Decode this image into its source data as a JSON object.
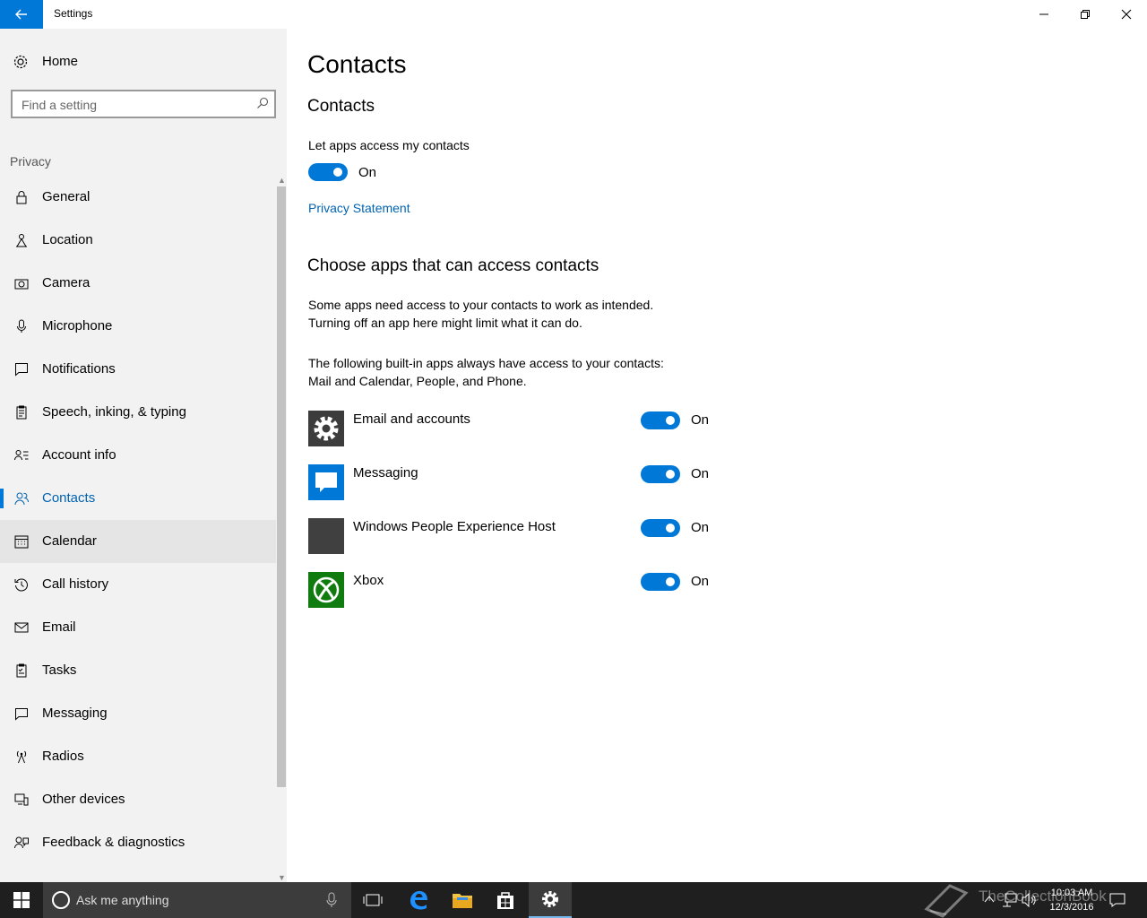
{
  "window": {
    "title": "Settings"
  },
  "sidebar": {
    "home_label": "Home",
    "search_placeholder": "Find a setting",
    "section_label": "Privacy",
    "items": [
      {
        "label": "General",
        "icon": "lock-icon"
      },
      {
        "label": "Location",
        "icon": "location-icon"
      },
      {
        "label": "Camera",
        "icon": "camera-icon"
      },
      {
        "label": "Microphone",
        "icon": "microphone-icon"
      },
      {
        "label": "Notifications",
        "icon": "notifications-icon"
      },
      {
        "label": "Speech, inking, & typing",
        "icon": "speech-icon"
      },
      {
        "label": "Account info",
        "icon": "account-info-icon"
      },
      {
        "label": "Contacts",
        "icon": "contacts-icon",
        "active": true
      },
      {
        "label": "Calendar",
        "icon": "calendar-icon",
        "hover": true
      },
      {
        "label": "Call history",
        "icon": "history-icon"
      },
      {
        "label": "Email",
        "icon": "email-icon"
      },
      {
        "label": "Tasks",
        "icon": "tasks-icon"
      },
      {
        "label": "Messaging",
        "icon": "messaging-icon"
      },
      {
        "label": "Radios",
        "icon": "radios-icon"
      },
      {
        "label": "Other devices",
        "icon": "other-devices-icon"
      },
      {
        "label": "Feedback & diagnostics",
        "icon": "feedback-icon"
      }
    ]
  },
  "main": {
    "page_title": "Contacts",
    "section1_title": "Contacts",
    "toggle_caption": "Let apps access my contacts",
    "main_toggle_state": "On",
    "privacy_link": "Privacy Statement",
    "section2_title": "Choose apps that can access contacts",
    "para1_line1": "Some apps need access to your contacts to work as intended.",
    "para1_line2": "Turning off an app here might limit what it can do.",
    "para2_line1": "The following built-in apps always have access to your contacts:",
    "para2_line2": "Mail and Calendar, People, and Phone.",
    "apps": [
      {
        "name": "Email and accounts",
        "state": "On",
        "icon": "gear-icon",
        "color": "#3c3c3c"
      },
      {
        "name": "Messaging",
        "state": "On",
        "icon": "speech-bubble-icon",
        "color": "#0078d7"
      },
      {
        "name": "Windows People Experience Host",
        "state": "On",
        "icon": "blank-app-icon",
        "color": "#404040"
      },
      {
        "name": "Xbox",
        "state": "On",
        "icon": "xbox-icon",
        "color": "#107c10"
      }
    ]
  },
  "taskbar": {
    "search_placeholder": "Ask me anything",
    "time": "10:03 AM",
    "date": "12/3/2016"
  },
  "watermark": "TheCollectionBook",
  "accent_color": "#0078d7"
}
